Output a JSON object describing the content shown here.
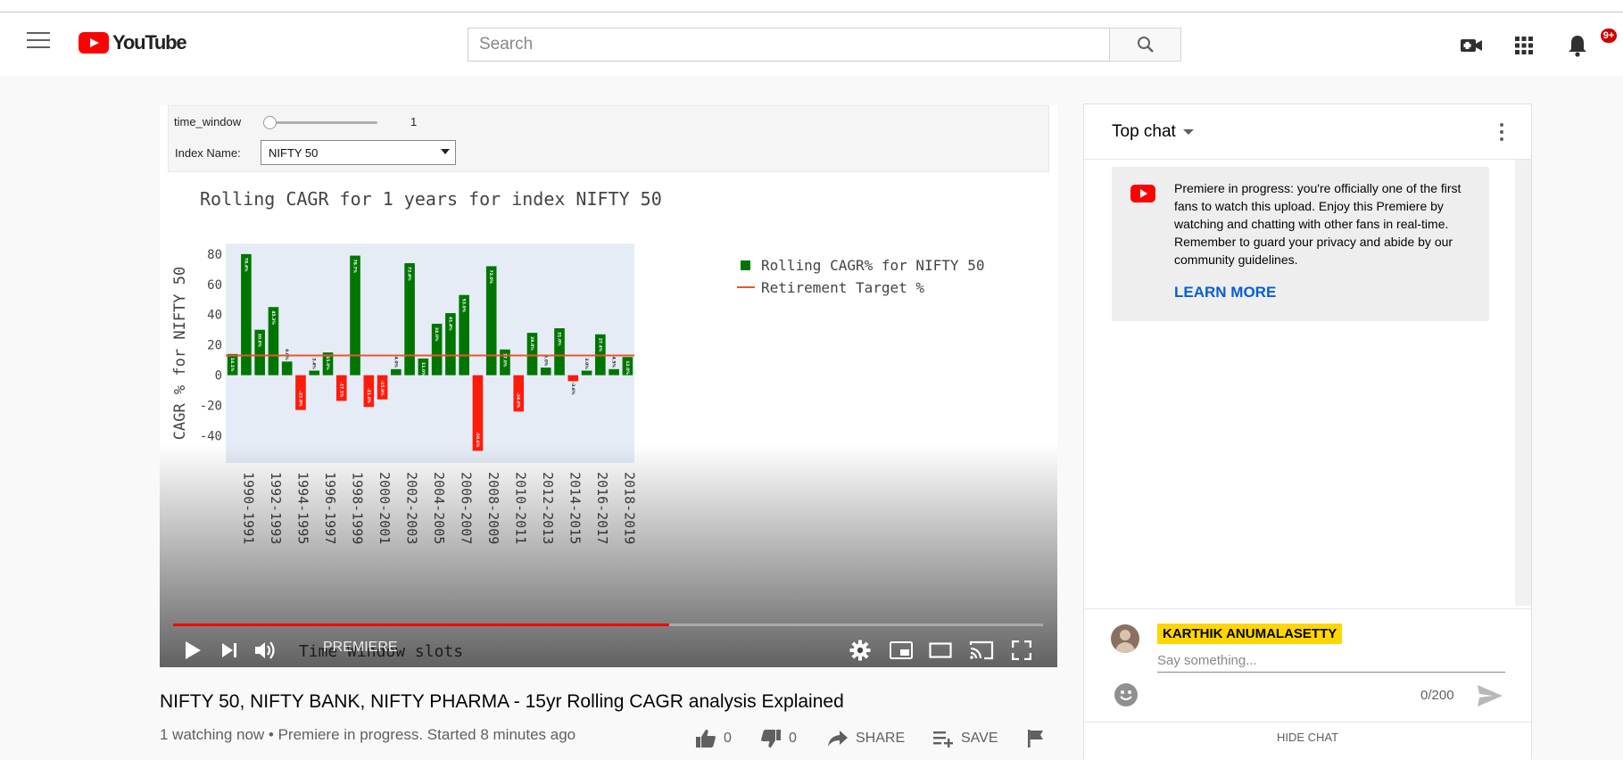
{
  "header": {
    "search_placeholder": "Search",
    "notification_count": "9+",
    "logo_text": "YouTube"
  },
  "player": {
    "widget_slider_label": "time_window",
    "widget_slider_value": "1",
    "widget_dropdown_label": "Index Name:",
    "widget_dropdown_value": "NIFTY 50",
    "premiere_label": "PREMIERE",
    "progress_fraction": 0.57
  },
  "chart_data": {
    "type": "bar",
    "title": "Rolling CAGR for 1 years for index NIFTY 50",
    "ylabel": "CAGR % for NIFTY 50",
    "xlabel": "Time Window slots",
    "ylim": [
      -58,
      87
    ],
    "yticks": [
      80,
      60,
      40,
      20,
      0,
      -20,
      -40
    ],
    "xticks": [
      "1990-1991",
      "1992-1993",
      "1994-1995",
      "1996-1997",
      "1998-1999",
      "2000-2001",
      "2002-2003",
      "2004-2005",
      "2006-2007",
      "2008-2009",
      "2010-2011",
      "2012-2013",
      "2014-2015",
      "2016-2017",
      "2018-2019"
    ],
    "series": [
      {
        "name": "Rolling CAGR% for NIFTY 50",
        "color": "#007500",
        "values": [
          14,
          80,
          30,
          45,
          9,
          -23,
          3,
          15,
          -17,
          79,
          -21,
          -16,
          4,
          74,
          11,
          34,
          41,
          53,
          -50,
          72,
          17,
          -24,
          28,
          5,
          31,
          -4,
          3,
          27,
          4,
          12
        ],
        "labels": [
          "14.1%",
          "78.4%",
          "30.0%",
          "45.3%",
          "9.0%",
          "-22.8%",
          "3.4%",
          "15.0%",
          "-17.1%",
          "78.7%",
          "-21.0%",
          "-15.9%",
          "4.0%",
          "72.4%",
          "11.0%",
          "34.0%",
          "41.4%",
          "53.0%",
          "-50.6%",
          "72.0%",
          "17.0%",
          "-24.0%",
          "28.0%",
          "5.0%",
          "31.0%",
          "-3.6%",
          "3.0%",
          "27.4%",
          "4.5%",
          "12.0%"
        ]
      },
      {
        "name": "Retirement Target %",
        "color": "#e8572b",
        "value": 13
      }
    ],
    "negative_color": "#ff1a0a",
    "grid": false,
    "legend_position": "right"
  },
  "video": {
    "title": "NIFTY 50, NIFTY BANK, NIFTY PHARMA - 15yr Rolling CAGR analysis Explained",
    "meta": "1 watching now • Premiere in progress. Started 8 minutes ago",
    "like_count": "0",
    "dislike_count": "0",
    "share_label": "SHARE",
    "save_label": "SAVE"
  },
  "chat": {
    "header_label": "Top chat",
    "notice_text": "Premiere in progress: you're officially one of the first fans to watch this upload. Enjoy this Premiere by watching and chatting with other fans in real-time. Remember to guard your privacy and abide by our community guidelines.",
    "learn_more": "LEARN MORE",
    "username": "KARTHIK ANUMALASETTY",
    "input_placeholder": "Say something...",
    "char_counter": "0/200",
    "hide_chat": "HIDE CHAT"
  },
  "icons": [
    "menu-icon",
    "youtube-logo-icon",
    "search-icon",
    "create-video-icon",
    "apps-grid-icon",
    "bell-icon",
    "play-icon",
    "next-icon",
    "volume-icon",
    "settings-gear-icon",
    "miniplayer-icon",
    "theater-icon",
    "cast-icon",
    "fullscreen-icon",
    "like-icon",
    "dislike-icon",
    "share-icon",
    "save-playlist-icon",
    "flag-icon",
    "emoji-icon",
    "send-icon"
  ]
}
